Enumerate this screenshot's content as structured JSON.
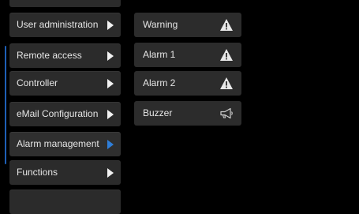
{
  "menu": {
    "items": [
      {
        "label": "User administration",
        "active": false
      },
      {
        "label": "Remote access",
        "active": false
      },
      {
        "label": "Controller",
        "active": false
      },
      {
        "label": "eMail Configuration",
        "active": false
      },
      {
        "label": "Alarm management",
        "active": true
      },
      {
        "label": "Functions",
        "active": false
      }
    ]
  },
  "alarms": {
    "items": [
      {
        "label": "Warning",
        "icon": "warning-triangle-icon"
      },
      {
        "label": "Alarm 1",
        "icon": "warning-triangle-icon"
      },
      {
        "label": "Alarm 2",
        "icon": "warning-triangle-icon"
      },
      {
        "label": "Buzzer",
        "icon": "megaphone-icon"
      }
    ]
  },
  "colors": {
    "background": "#000000",
    "item_background": "#2b2b2b",
    "accent": "#2f7ed8",
    "text": "#e6e6e6"
  }
}
